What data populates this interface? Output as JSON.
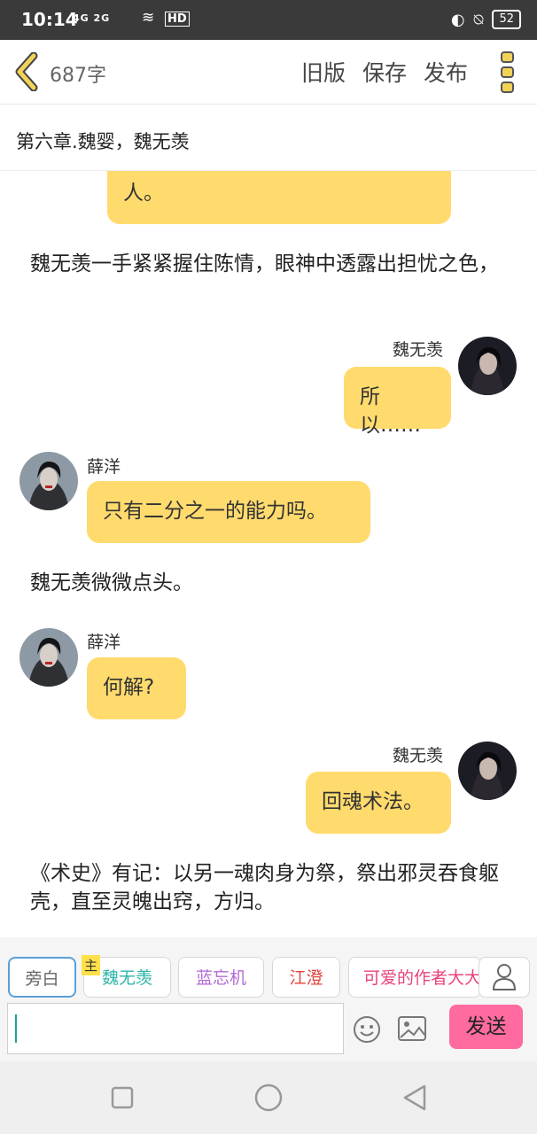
{
  "status": {
    "time": "10:14",
    "signal": "4G 2G",
    "hd": "HD",
    "battery": "52"
  },
  "topbar": {
    "word_count": "687字",
    "old_version": "旧版",
    "save": "保存",
    "publish": "发布"
  },
  "chapter": {
    "title": "第六章.魏婴，魏无羡"
  },
  "chat": {
    "top_bubble_tail": "人。",
    "narration_1": "魏无羡一手紧紧握住陈情，眼神中透露出担忧之色，",
    "msg_1": {
      "name": "魏无羡",
      "text": "所以……"
    },
    "msg_2": {
      "name": "薛洋",
      "text": "只有二分之一的能力吗。"
    },
    "narration_2": "魏无羡微微点头。",
    "msg_3": {
      "name": "薛洋",
      "text": "何解?"
    },
    "msg_4": {
      "name": "魏无羡",
      "text": "回魂术法。"
    },
    "narration_3": "《术史》有记：以另一魂肉身为祭，祭出邪灵吞食躯壳，直至灵魄出窍，方归。"
  },
  "roles": {
    "narrator": "旁白",
    "main_badge": "主",
    "r1": "魏无羡",
    "r2": "蓝忘机",
    "r3": "江澄",
    "r4": "可爱的作者大大",
    "send": "发送"
  },
  "colors": {
    "bubble": "#ffdb6e",
    "accent_back": "#e8c84a",
    "role_r1": "#2bb5a8",
    "role_r2": "#b36ad6",
    "role_r3": "#e0443c",
    "role_r4": "#e8447a",
    "send": "#ff6aa0"
  }
}
